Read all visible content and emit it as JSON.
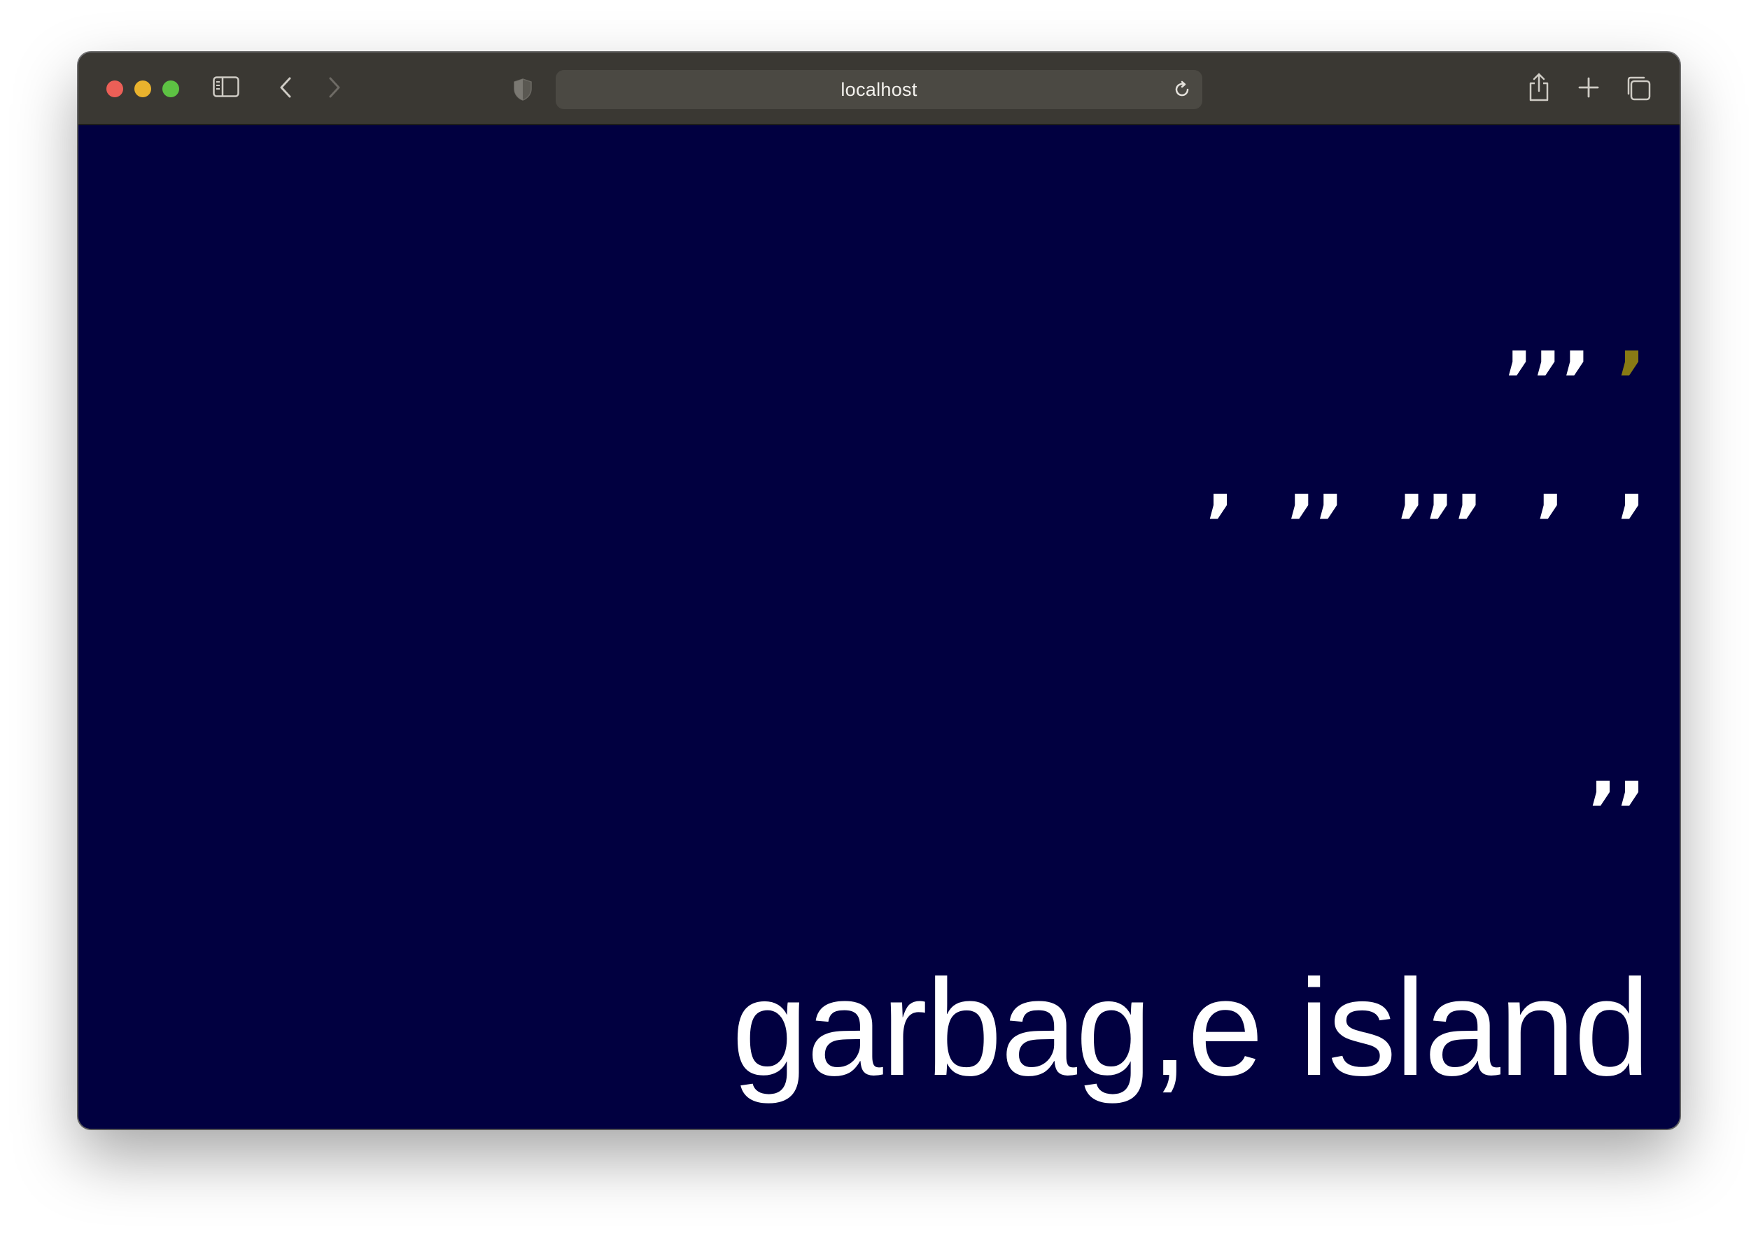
{
  "browser": {
    "url": "localhost",
    "icons": {
      "sidebar": "sidebar-icon",
      "back": "chevron-left-icon",
      "forward": "chevron-right-icon",
      "privacy": "shield-icon",
      "reload": "reload-icon",
      "share": "share-icon",
      "new_tab": "plus-icon",
      "tab_overview": "tabs-icon"
    }
  },
  "page": {
    "background_color": "#010040",
    "text_color": "#ffffff",
    "accent_color": "#887a14",
    "row1_main": ",,, ",
    "row1_accent": ",",
    "row2": ",  ,,  ,,,  ,  ,",
    "row3": ",,",
    "headline": "garbag,e island"
  }
}
